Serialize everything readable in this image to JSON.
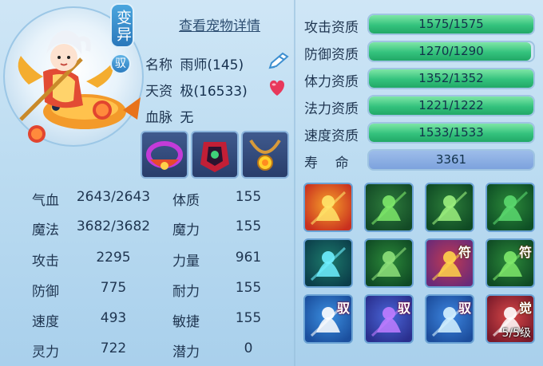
{
  "pet": {
    "mutant_badge": "变异",
    "tame_badge": "驭",
    "view_details": "查看宠物详情",
    "name_label": "名称",
    "name_value": "雨师(145)",
    "talent_label": "天资",
    "talent_value": "极(16533)",
    "bloodline_label": "血脉",
    "bloodline_value": "无"
  },
  "stats": [
    {
      "label": "气血",
      "value": "2643/2643"
    },
    {
      "label": "魔法",
      "value": "3682/3682"
    },
    {
      "label": "攻击",
      "value": "2295"
    },
    {
      "label": "防御",
      "value": "775"
    },
    {
      "label": "速度",
      "value": "493"
    },
    {
      "label": "灵力",
      "value": "722"
    }
  ],
  "attrs": [
    {
      "label": "体质",
      "value": "155"
    },
    {
      "label": "魔力",
      "value": "155"
    },
    {
      "label": "力量",
      "value": "961"
    },
    {
      "label": "耐力",
      "value": "155"
    },
    {
      "label": "敏捷",
      "value": "155"
    },
    {
      "label": "潜力",
      "value": "0"
    }
  ],
  "qualities": [
    {
      "label": "攻击资质",
      "value": "1575/1575",
      "fraction": 1.0
    },
    {
      "label": "防御资质",
      "value": "1270/1290",
      "fraction": 0.9845
    },
    {
      "label": "体力资质",
      "value": "1352/1352",
      "fraction": 1.0
    },
    {
      "label": "法力资质",
      "value": "1221/1222",
      "fraction": 0.9992
    },
    {
      "label": "速度资质",
      "value": "1533/1533",
      "fraction": 1.0
    }
  ],
  "life": {
    "label": "寿    命",
    "value": "3361"
  },
  "skills": [
    {
      "name": "sword-skill-icon",
      "tag": ""
    },
    {
      "name": "green-shadow-strike-icon",
      "tag": ""
    },
    {
      "name": "green-warrior-slash-icon",
      "tag": ""
    },
    {
      "name": "green-beast-icon",
      "tag": ""
    },
    {
      "name": "blue-flame-icon",
      "tag": ""
    },
    {
      "name": "green-giant-icon",
      "tag": ""
    },
    {
      "name": "golden-seal-icon",
      "tag": "符"
    },
    {
      "name": "green-demon-icon",
      "tag": "符"
    },
    {
      "name": "blue-mount-icon",
      "tag": "驭"
    },
    {
      "name": "purple-fist-icon",
      "tag": "驭"
    },
    {
      "name": "blue-blade-icon",
      "tag": "驭"
    },
    {
      "name": "awaken-red-icon",
      "tag": "觉",
      "level": "5/5级"
    }
  ],
  "colors": {
    "bar_green": "#34c27d",
    "life_blue": "#7da2dd",
    "panel_bg": "#bcdcf1"
  }
}
